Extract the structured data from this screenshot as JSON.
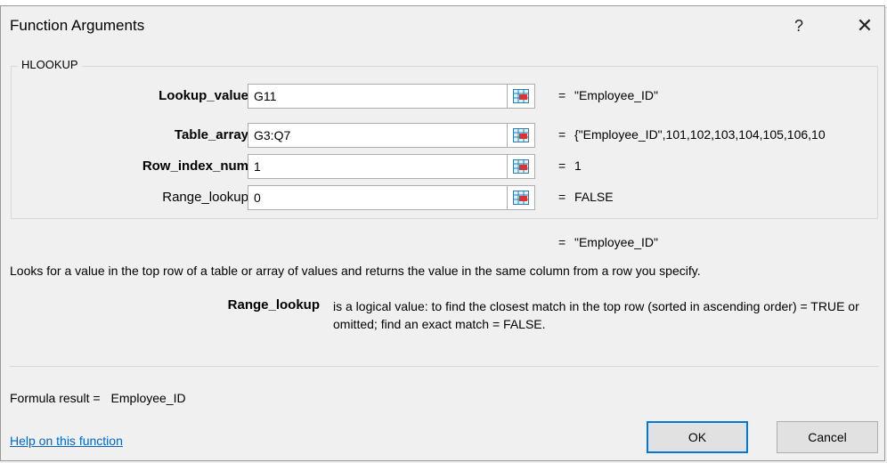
{
  "background": {
    "text": ""
  },
  "dialog": {
    "title": "Function Arguments",
    "help_glyph": "?",
    "close_glyph": "✕"
  },
  "function": {
    "name": "HLOOKUP",
    "arguments": [
      {
        "label": "Lookup_value",
        "bold": true,
        "value": "G11",
        "result": "\"Employee_ID\""
      },
      {
        "label": "Table_array",
        "bold": true,
        "value": "G3:Q7",
        "result": "{\"Employee_ID\",101,102,103,104,105,106,10"
      },
      {
        "label": "Row_index_num",
        "bold": true,
        "value": "1",
        "result": "1"
      },
      {
        "label": "Range_lookup",
        "bold": false,
        "value": "0",
        "result": "FALSE"
      }
    ],
    "equals": "=",
    "overall_result": "\"Employee_ID\"",
    "description": "Looks for a value in the top row of a table or array of values and returns the value in the same column from a row you specify.",
    "selected_arg_name": "Range_lookup",
    "selected_arg_description": "is a logical value: to find the closest match in the top row (sorted in ascending order) = TRUE or omitted; find an exact match = FALSE."
  },
  "footer": {
    "formula_result_label": "Formula result =",
    "formula_result_value": "Employee_ID",
    "help_link": "Help on this function",
    "ok_label": "OK",
    "cancel_label": "Cancel"
  },
  "icons": {
    "ref_button": "collapse-dialog-icon"
  },
  "colors": {
    "link": "#0066cc",
    "default_button_border": "#0078d7"
  }
}
